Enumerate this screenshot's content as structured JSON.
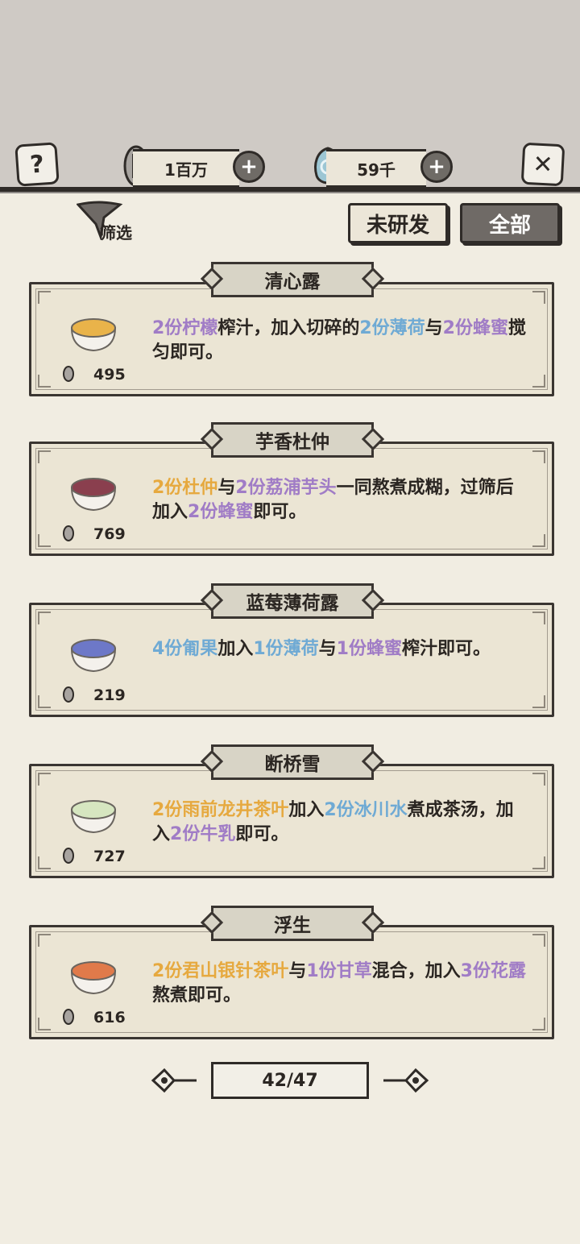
{
  "header": {
    "coins": "1百万",
    "gems": "59千"
  },
  "filter": {
    "label": "筛选"
  },
  "tabs": {
    "undeveloped": "未研发",
    "all": "全部"
  },
  "recipes": [
    {
      "name": "清心露",
      "price": "495",
      "dish_color": "#e9b34a",
      "desc": [
        {
          "t": "2份柠檬",
          "c": "purple"
        },
        {
          "t": "榨汁，加入切碎的",
          "c": "dark"
        },
        {
          "t": "2份薄荷",
          "c": "blue"
        },
        {
          "t": "与",
          "c": "dark"
        },
        {
          "t": "2份蜂蜜",
          "c": "purple"
        },
        {
          "t": "搅匀即可。",
          "c": "dark"
        }
      ]
    },
    {
      "name": "芋香杜仲",
      "price": "769",
      "dish_color": "#8a3f4e",
      "desc": [
        {
          "t": "2份杜仲",
          "c": "orange"
        },
        {
          "t": "与",
          "c": "dark"
        },
        {
          "t": "2份荔浦芋头",
          "c": "purple"
        },
        {
          "t": "一同熬煮成糊，过筛后加入",
          "c": "dark"
        },
        {
          "t": "2份蜂蜜",
          "c": "purple"
        },
        {
          "t": "即可。",
          "c": "dark"
        }
      ]
    },
    {
      "name": "蓝莓薄荷露",
      "price": "219",
      "dish_color": "#6d78c8",
      "desc": [
        {
          "t": "4份匍果",
          "c": "blue"
        },
        {
          "t": "加入",
          "c": "dark"
        },
        {
          "t": "1份薄荷",
          "c": "blue"
        },
        {
          "t": "与",
          "c": "dark"
        },
        {
          "t": "1份蜂蜜",
          "c": "purple"
        },
        {
          "t": "榨汁即可。",
          "c": "dark"
        }
      ]
    },
    {
      "name": "断桥雪",
      "price": "727",
      "dish_color": "#d6e6c0",
      "desc": [
        {
          "t": "2份雨前龙井茶叶",
          "c": "orange"
        },
        {
          "t": "加入",
          "c": "dark"
        },
        {
          "t": "2份冰川水",
          "c": "blue"
        },
        {
          "t": "煮成茶汤，加入",
          "c": "dark"
        },
        {
          "t": "2份牛乳",
          "c": "purple"
        },
        {
          "t": "即可。",
          "c": "dark"
        }
      ]
    },
    {
      "name": "浮生",
      "price": "616",
      "dish_color": "#e07a4a",
      "desc": [
        {
          "t": "2份君山银针茶叶",
          "c": "orange"
        },
        {
          "t": "与",
          "c": "dark"
        },
        {
          "t": "1份甘草",
          "c": "purple"
        },
        {
          "t": "混合，加入",
          "c": "dark"
        },
        {
          "t": "3份花露",
          "c": "purple"
        },
        {
          "t": "熬煮即可。",
          "c": "dark"
        }
      ]
    }
  ],
  "pagination": {
    "page": "42/47"
  },
  "colors": {
    "orange": "#e6a93f",
    "purple": "#a07cc6",
    "blue": "#6faad4",
    "dark": "#2b2622"
  }
}
